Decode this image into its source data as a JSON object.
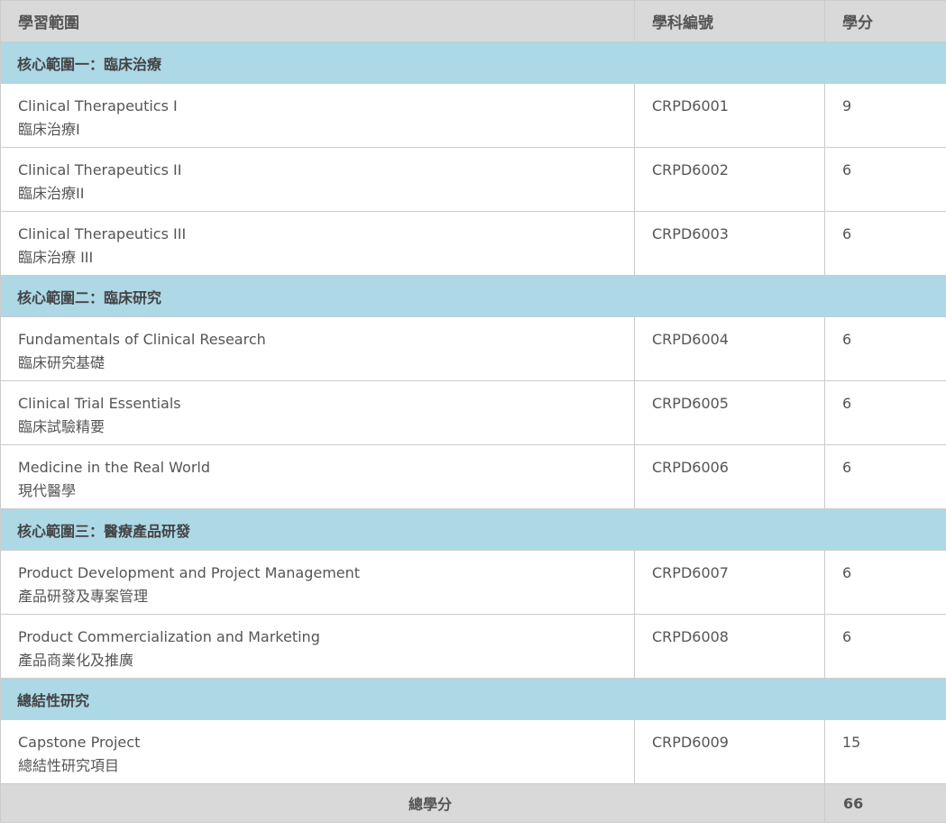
{
  "header": {
    "col_area": "學習範圍",
    "col_code": "學科編號",
    "col_credits": "學分"
  },
  "sections": [
    {
      "title": "核心範圍一：臨床治療",
      "courses": [
        {
          "en": "Clinical Therapeutics I",
          "zh": "臨床治療I",
          "code": "CRPD6001",
          "credits": "9"
        },
        {
          "en": "Clinical Therapeutics II",
          "zh": "臨床治療II",
          "code": "CRPD6002",
          "credits": "6"
        },
        {
          "en": "Clinical Therapeutics III",
          "zh": "臨床治療 III",
          "code": "CRPD6003",
          "credits": "6"
        }
      ]
    },
    {
      "title": "核心範圍二：臨床研究",
      "courses": [
        {
          "en": "Fundamentals of Clinical Research",
          "zh": "臨床研究基礎",
          "code": "CRPD6004",
          "credits": "6"
        },
        {
          "en": "Clinical Trial Essentials",
          "zh": "臨床試驗精要",
          "code": "CRPD6005",
          "credits": "6"
        },
        {
          "en": "Medicine in the Real World",
          "zh": "現代醫學",
          "code": "CRPD6006",
          "credits": "6"
        }
      ]
    },
    {
      "title": "核心範圍三：醫療產品研發",
      "courses": [
        {
          "en": "Product Development and Project Management",
          "zh": "產品研發及專案管理",
          "code": "CRPD6007",
          "credits": "6"
        },
        {
          "en": "Product Commercialization and Marketing",
          "zh": "產品商業化及推廣",
          "code": "CRPD6008",
          "credits": "6"
        }
      ]
    },
    {
      "title": "總結性研究",
      "courses": [
        {
          "en": "Capstone Project",
          "zh": "總結性研究項目",
          "code": "CRPD6009",
          "credits": "15"
        }
      ]
    }
  ],
  "total": {
    "label": "總學分",
    "value": "66"
  }
}
